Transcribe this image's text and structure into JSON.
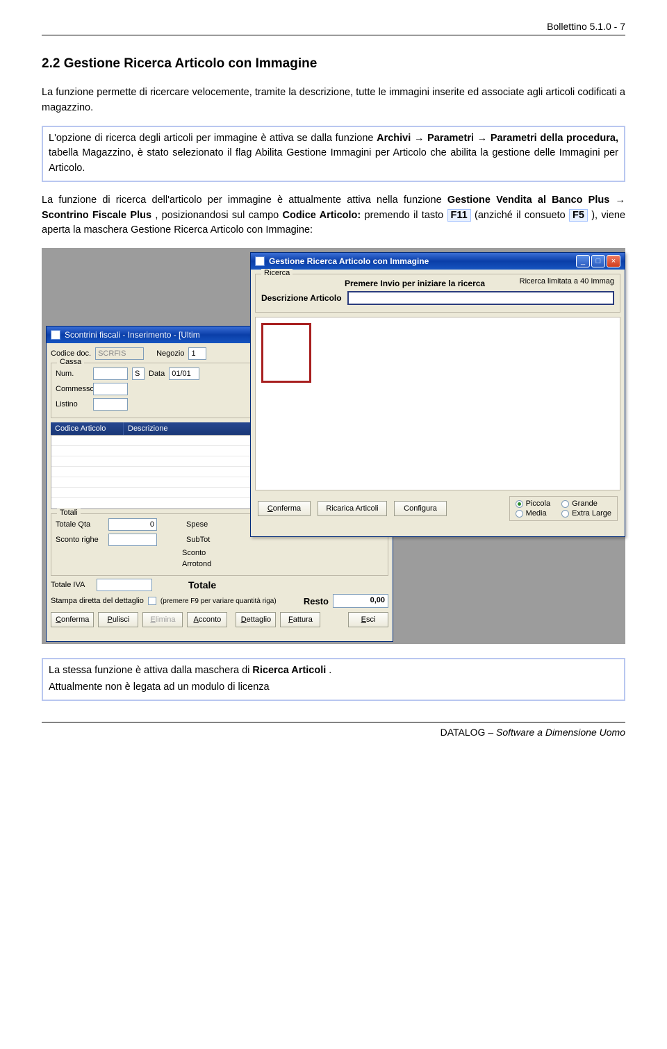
{
  "header": {
    "page_label": "Bollettino 5.1.0 - 7"
  },
  "section": {
    "title": "2.2 Gestione Ricerca Articolo con Immagine"
  },
  "p1": "La funzione permette di ricercare velocemente, tramite la descrizione, tutte le immagini inserite ed associate agli articoli codificati a magazzino.",
  "boxA": {
    "t1": "L'opzione di ricerca degli articoli per immagine è attiva se dalla funzione ",
    "b1": "Archivi",
    "arrow": " → ",
    "b2": "Parametri",
    "b3": "Parametri della procedura,",
    "t2": " tabella Magazzino, è stato selezionato il flag Abilita Gestione Immagini per Articolo che abilita la gestione delle Immagini per Articolo."
  },
  "p2": {
    "t1": "La funzione di ricerca dell'articolo per immagine è attualmente attiva nella funzione ",
    "b1": "Gestione Vendita al Banco Plus",
    "b2": "Scontrino Fiscale Plus",
    "t2": ", posizionandosi sul campo ",
    "b3": "Codice Articolo:",
    "t3": " premendo il tasto ",
    "k1": "F11",
    "t4": " (anziché il consueto ",
    "k2": "F5",
    "t5": " ), viene aperta la maschera Gestione Ricerca Articolo con Immagine:"
  },
  "back": {
    "title": "Scontrini fiscali  - Inserimento  - [Ultim",
    "codice_doc_lbl": "Codice doc.",
    "codice_doc_val": "SCRFIS",
    "negozio_lbl": "Negozio",
    "negozio_val": "1",
    "cassa": "Cassa",
    "num_lbl": "Num.",
    "num_val": "S",
    "data_lbl": "Data",
    "data_val": "01/01",
    "commesso_lbl": "Commesso",
    "listino_lbl": "Listino",
    "col1": "Codice Articolo",
    "col2": "Descrizione",
    "totali": "Totali",
    "totale_qta_lbl": "Totale Qta",
    "totale_qta_val": "0",
    "spese_lbl": "Spese",
    "sconto_righe_lbl": "Sconto righe",
    "subtot_lbl": "SubTot",
    "sconto_lbl": "Sconto",
    "arrot_lbl": "Arrotond",
    "totale_iva_lbl": "Totale IVA",
    "totale_lbl": "Totale",
    "stampa_lbl": "Stampa diretta del dettaglio",
    "hint": "(premere F9 per variare quantità riga)",
    "resto_lbl": "Resto",
    "resto_val": "0,00",
    "btn_conferma": "Conferma",
    "btn_pulisci": "Pulisci",
    "btn_elimina": "Elimina",
    "btn_acconto": "Acconto",
    "btn_dettaglio": "Dettaglio",
    "btn_fattura": "Fattura",
    "btn_esci": "Esci"
  },
  "front": {
    "title": "Gestione Ricerca Articolo con Immagine",
    "legend": "Ricerca",
    "prompt": "Premere Invio per iniziare la ricerca",
    "limit": "Ricerca limitata a 40 Immag",
    "desc_lbl": "Descrizione Articolo",
    "btn_conferma": "Conferma",
    "btn_ricarica": "Ricarica Articoli",
    "btn_configura": "Configura",
    "r_piccola": "Piccola",
    "r_grande": "Grande",
    "r_media": "Media",
    "r_extra": "Extra Large"
  },
  "boxB": {
    "l1": "La stessa funzione è attiva dalla maschera di ",
    "b1": "Ricerca Articoli",
    "l1b": ".",
    "l2": "Attualmente non è legata ad un modulo di licenza"
  },
  "footer": {
    "brand": "DATALOG",
    "tag": " – Software a Dimensione Uomo"
  }
}
